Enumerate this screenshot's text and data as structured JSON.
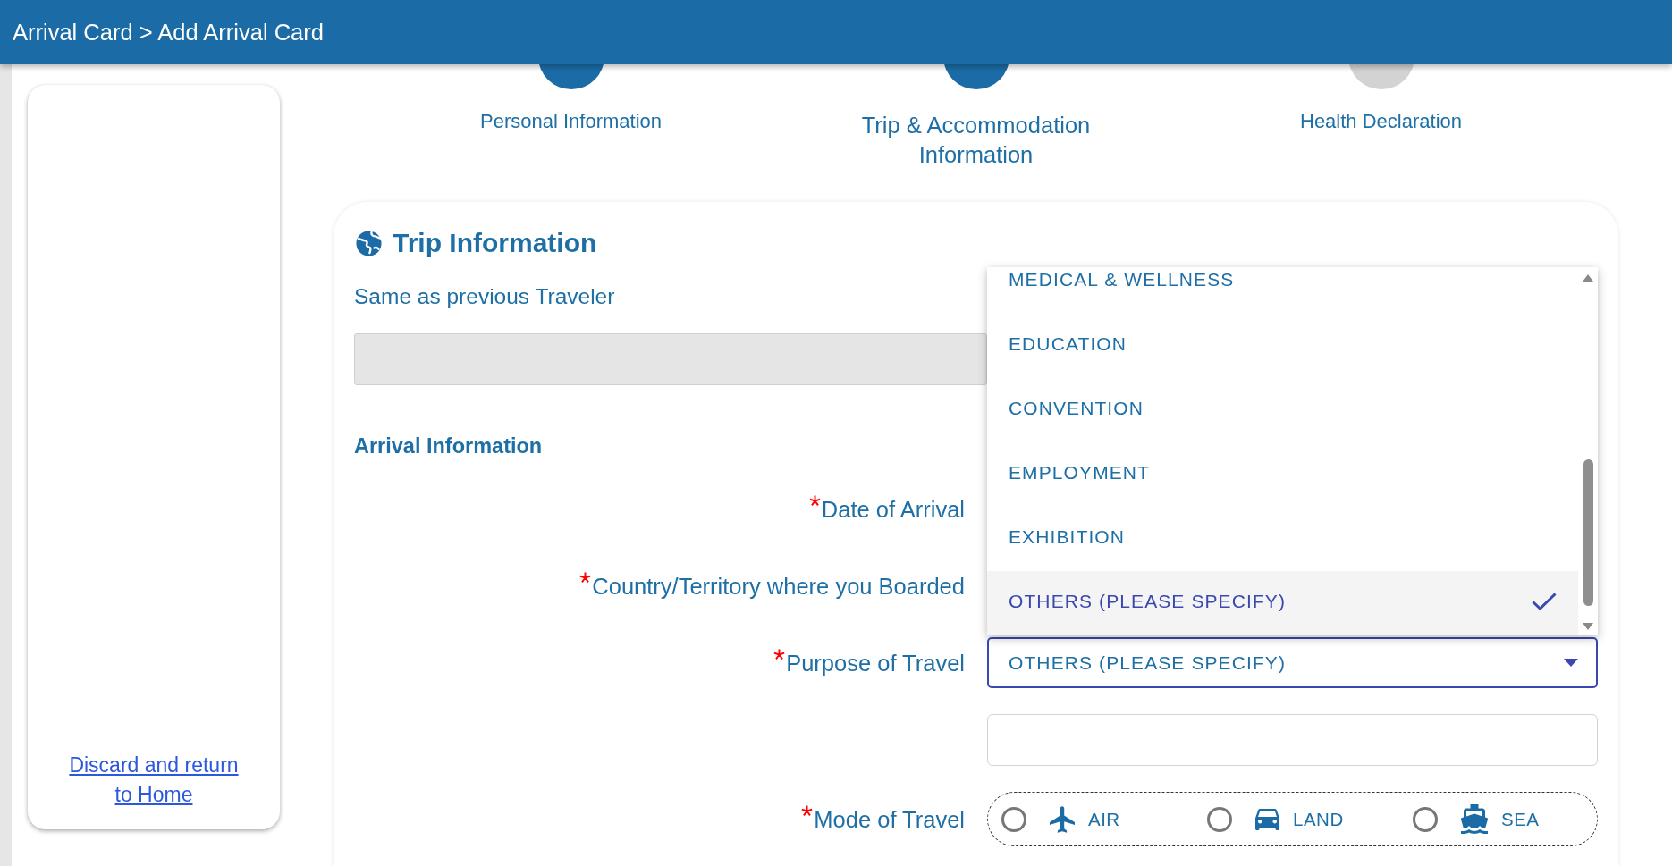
{
  "header": {
    "title": "Arrival Card > Add Arrival Card"
  },
  "sidebar": {
    "link": "Discard and return to Home"
  },
  "steps": [
    {
      "label": "Personal Information",
      "selected": false
    },
    {
      "label": "Trip & Accommodation Information",
      "selected": true
    },
    {
      "label": "Health Declaration",
      "selected": false
    }
  ],
  "trip_information": {
    "title": "Trip Information",
    "same_as_previous": {
      "label": "Same as previous Traveler",
      "disabled": true
    },
    "arrival_information": {
      "heading": "Arrival Information",
      "fields": [
        {
          "label": "Date of Arrival",
          "required": true
        },
        {
          "label": "Country/Territory where you Boarded",
          "required": true
        },
        {
          "kind": "select",
          "label": "Purpose of Travel",
          "required": true,
          "value": "OTHERS (PLEASE SPECIFY)",
          "open": true,
          "options": [
            {
              "label": "MEDICAL & WELLNESS",
              "selected": false
            },
            {
              "label": "EDUCATION",
              "selected": false
            },
            {
              "label": "CONVENTION",
              "selected": false
            },
            {
              "label": "EMPLOYMENT",
              "selected": false
            },
            {
              "label": "EXHIBITION",
              "selected": false
            },
            {
              "label": "OTHERS (PLEASE SPECIFY)",
              "selected": true
            }
          ]
        },
        {
          "kind": "text"
        },
        {
          "kind": "radio",
          "label": "Mode of Travel",
          "required": true,
          "options": [
            {
              "kind": "air",
              "label": "AIR",
              "selected": false
            },
            {
              "kind": "land",
              "label": "LAND",
              "selected": false
            },
            {
              "kind": "sea",
              "label": "SEA",
              "selected": false
            }
          ]
        }
      ]
    }
  }
}
